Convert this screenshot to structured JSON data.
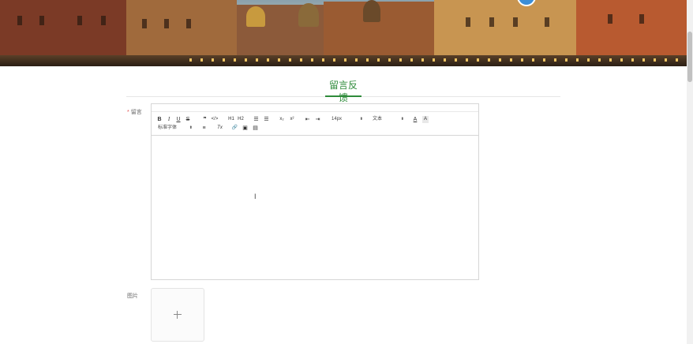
{
  "page": {
    "title": "留言反馈",
    "accent_color": "#2e8b3a"
  },
  "form": {
    "message_label": "留言",
    "required_mark": "*",
    "image_label": "图片"
  },
  "toolbar": {
    "bold": "B",
    "italic": "I",
    "underline": "U",
    "strike": "S",
    "quote": "❞",
    "code": "</>",
    "h1": "H1",
    "h2": "H2",
    "ordered_list": "☰",
    "bullet_list": "☰",
    "subscript": "x₂",
    "superscript": "x²",
    "outdent": "⇤",
    "indent": "⇥",
    "font_size": "14px",
    "header_select": "文本",
    "font_color": "A",
    "background_color": "A",
    "font_family": "标准字体",
    "align": "≡",
    "clean": "Tx",
    "link": "🔗",
    "image": "▣",
    "video": "▤",
    "dropdown_arrow": "⬍"
  },
  "editor": {
    "caret_glyph": "I"
  },
  "upload": {
    "icon": "plus-icon"
  }
}
